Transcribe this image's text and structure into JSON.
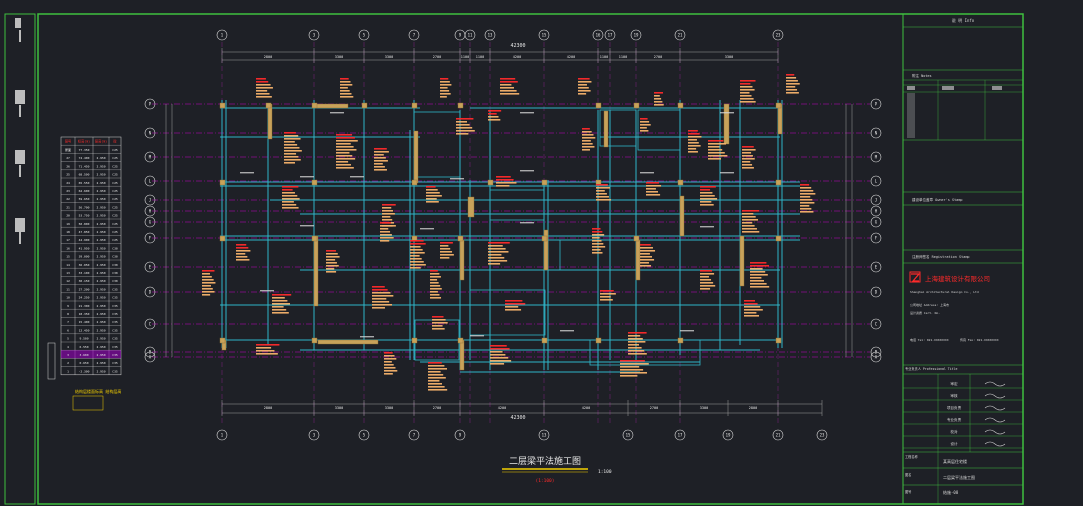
{
  "drawing": {
    "title": "二层梁平法施工图",
    "scale_label": "1:100",
    "subtitle": "(1:100)"
  },
  "grid": {
    "top_axes": [
      "1",
      "3",
      "5",
      "7",
      "9",
      "11",
      "13",
      "15",
      "16",
      "17",
      "19",
      "21",
      "23"
    ],
    "bottom_axes": [
      "1",
      "3",
      "5",
      "7",
      "9",
      "13",
      "15",
      "17",
      "19",
      "21",
      "23"
    ],
    "left_axes": [
      "P",
      "N",
      "M",
      "L",
      "J",
      "H",
      "G",
      "F",
      "E",
      "D",
      "C",
      "B",
      "A"
    ],
    "right_axes": [
      "P",
      "N",
      "M",
      "L",
      "J",
      "H",
      "G",
      "F",
      "E",
      "D",
      "C",
      "B",
      "A"
    ],
    "top_dims": [
      "2800",
      "3300",
      "3300",
      "2700",
      "1100",
      "1100",
      "4200",
      "4200",
      "1100",
      "1100",
      "2700",
      "3300",
      "2800"
    ],
    "bottom_dims": [
      "2800",
      "3300",
      "3300",
      "2700",
      "4200",
      "4200",
      "2700",
      "3300",
      "2800"
    ],
    "overall_dim": "42300"
  },
  "floor_table": {
    "headers": [
      "层号",
      "标高(m)",
      "层高(m)",
      "砼"
    ],
    "rows": [
      [
        "屋面",
        "77.350",
        "",
        "C25"
      ],
      [
        "27",
        "74.400",
        "2.950",
        "C25"
      ],
      [
        "26",
        "71.450",
        "2.950",
        "C25"
      ],
      [
        "25",
        "68.500",
        "2.950",
        "C25"
      ],
      [
        "24",
        "65.550",
        "2.950",
        "C25"
      ],
      [
        "23",
        "62.600",
        "2.950",
        "C25"
      ],
      [
        "22",
        "59.650",
        "2.950",
        "C25"
      ],
      [
        "21",
        "56.700",
        "2.950",
        "C25"
      ],
      [
        "20",
        "53.750",
        "2.950",
        "C25"
      ],
      [
        "19",
        "50.800",
        "2.950",
        "C25"
      ],
      [
        "18",
        "47.850",
        "2.950",
        "C25"
      ],
      [
        "17",
        "44.900",
        "2.950",
        "C25"
      ],
      [
        "16",
        "41.950",
        "2.950",
        "C30"
      ],
      [
        "15",
        "39.000",
        "2.950",
        "C30"
      ],
      [
        "14",
        "36.050",
        "2.950",
        "C30"
      ],
      [
        "13",
        "33.100",
        "2.950",
        "C30"
      ],
      [
        "12",
        "30.150",
        "2.950",
        "C30"
      ],
      [
        "11",
        "27.200",
        "2.950",
        "C35"
      ],
      [
        "10",
        "24.250",
        "2.950",
        "C35"
      ],
      [
        "9",
        "21.300",
        "2.950",
        "C35"
      ],
      [
        "8",
        "18.350",
        "2.950",
        "C35"
      ],
      [
        "7",
        "15.400",
        "2.950",
        "C35"
      ],
      [
        "6",
        "12.450",
        "2.950",
        "C35"
      ],
      [
        "5",
        "9.500",
        "2.950",
        "C35"
      ],
      [
        "4",
        "6.550",
        "2.950",
        "C35"
      ],
      [
        "3",
        "3.600",
        "2.950",
        "C35"
      ],
      [
        "2",
        "0.650",
        "2.950",
        "C35"
      ],
      [
        "1",
        "-2.300",
        "2.950",
        "C35"
      ]
    ],
    "footer": "结构层楼面标高 结构层高"
  },
  "title_block": {
    "info_label": "说 明 Info",
    "notes_label": "附注 Notes",
    "client_label": "建设单位 Client",
    "owner_stamp_label": "建设单位盖章 Owner's Stamp",
    "reg_stamp_label": "注册师签名 Registration Stamp",
    "company_name_cn": "上海建筑设计有限公司",
    "company_name_en": "Shanghai Architectural Design Co., Ltd",
    "address_lines": [
      "公司地址 Address: 上海市",
      "设计资质 Cert. No.",
      "电话 Tel: 021-XXXXXXXX",
      "传真 Fax: 021-XXXXXXXX"
    ],
    "professional_label": "专业负责人 Professional Title",
    "signature_rows": [
      "审定",
      "审核",
      "项目负责",
      "专业负责",
      "校对",
      "设计"
    ],
    "project_label": "工程名称",
    "project_name": "某高层住宅楼",
    "drawing_name_label": "图名",
    "drawing_name": "二层梁平法施工图",
    "drawing_no_label": "图号",
    "drawing_no": "结施-08"
  },
  "colors": {
    "background": "#1e2026",
    "border": "#3fbf3f",
    "axis": "#d8d8d8",
    "beam": "#2fb5c8",
    "column": "#c8a25a",
    "annotation_red": "#ff2a2a",
    "annotation_orange": "#f7b36b",
    "guide_magenta": "#c400c4",
    "dimension": "#a0a0a0",
    "title_yellow": "#f4d000",
    "text_white": "#e8e8e8"
  },
  "icons": [
    "company-logo-icon",
    "binding-strip-icon"
  ]
}
